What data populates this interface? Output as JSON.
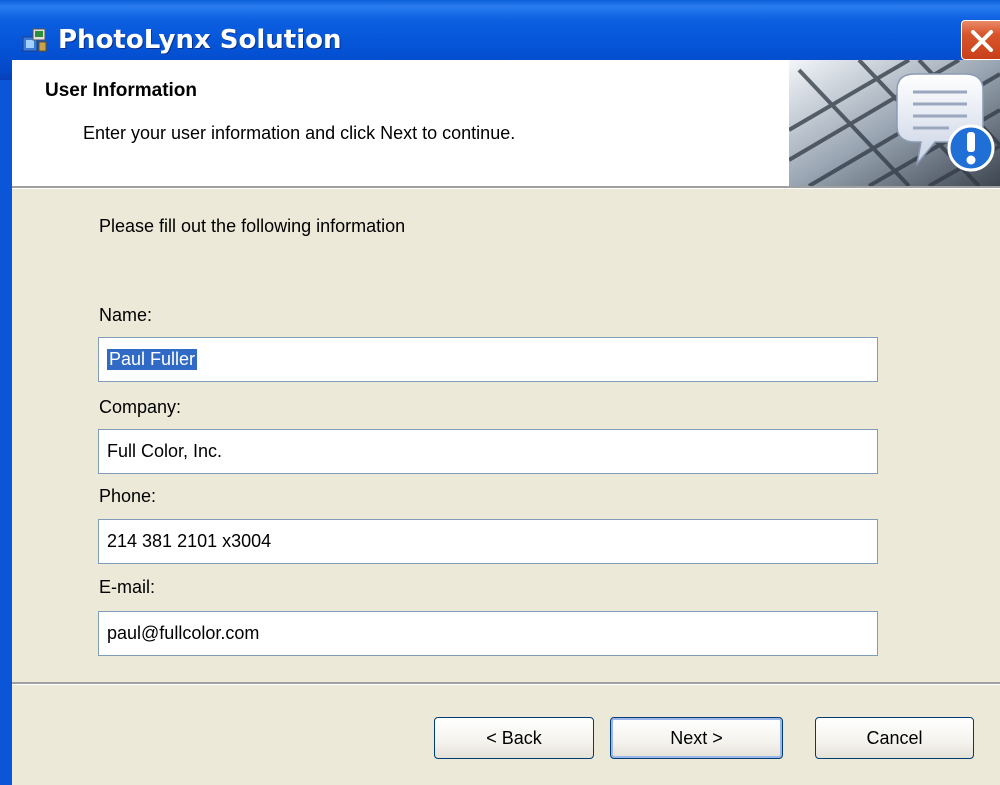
{
  "window": {
    "title": "PhotoLynx Solution",
    "close_icon": "close-icon",
    "app_icon": "installer-icon"
  },
  "header": {
    "title": "User Information",
    "description": "Enter your user information and click Next to continue.",
    "banner_icon": "keyboard-chat-alert-icon"
  },
  "form": {
    "instruction": "Please fill out the following information",
    "name_label": "Name:",
    "name_value": "Paul Fuller",
    "company_label": "Company:",
    "company_value": "Full Color, Inc.",
    "phone_label": "Phone:",
    "phone_value": "214 381 2101 x3004",
    "email_label": "E-mail:",
    "email_value": "paul@fullcolor.com"
  },
  "buttons": {
    "back": "< Back",
    "next": "Next >",
    "cancel": "Cancel"
  },
  "colors": {
    "titlebar": "#0553d6",
    "dialog_bg": "#ece9d8",
    "selection": "#316ac5",
    "close": "#d8552b"
  }
}
